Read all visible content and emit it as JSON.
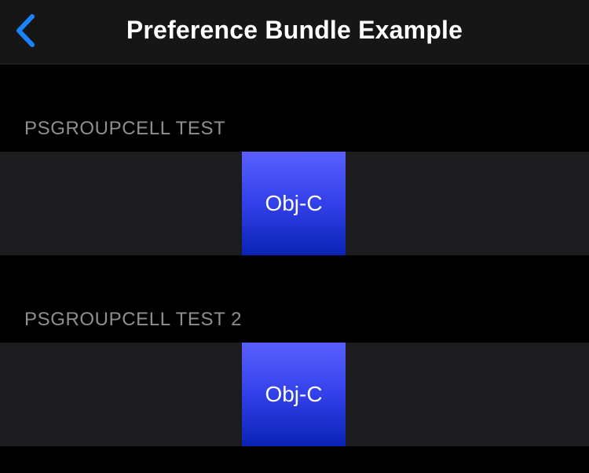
{
  "nav": {
    "title": "Preference Bundle Example",
    "back_icon": "chevron-left-icon",
    "accent_color": "#1a84ff"
  },
  "sections": [
    {
      "header": "PSGROUPCELL TEST",
      "tile": {
        "label": "Obj-C"
      }
    },
    {
      "header": "PSGROUPCELL TEST 2",
      "tile": {
        "label": "Obj-C"
      }
    }
  ],
  "colors": {
    "background": "#000000",
    "nav_background": "#161616",
    "cell_background": "#1c1c1e",
    "header_text": "#8e8e93",
    "tile_gradient_top": "#5a60ff",
    "tile_gradient_bottom": "#0a22b4"
  }
}
